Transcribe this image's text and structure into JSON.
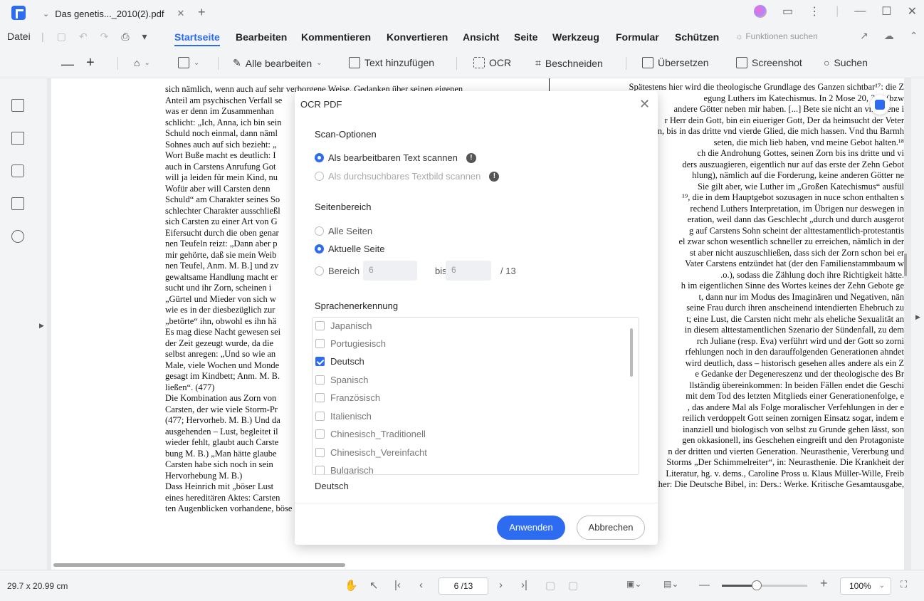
{
  "tab": {
    "title": "Das genetis..._2010(2).pdf"
  },
  "menu": {
    "datei": "Datei",
    "items": [
      "Startseite",
      "Bearbeiten",
      "Kommentieren",
      "Konvertieren",
      "Ansicht",
      "Seite",
      "Werkzeug",
      "Formular",
      "Schützen"
    ],
    "search_features": "Funktionen suchen"
  },
  "toolbar": {
    "edit_all": "Alle bearbeiten",
    "add_text": "Text hinzufügen",
    "ocr": "OCR",
    "crop": "Beschneiden",
    "translate": "Übersetzen",
    "screenshot": "Screenshot",
    "search": "Suchen"
  },
  "document": {
    "left_page": [
      "sich nämlich, wenn auch auf sehr verborgene Weise, Gedanken über seinen eigenen",
      "Anteil am psychischen Verfall se",
      "was er denn im Zusammenhan",
      "schlicht: „Ich, Anna, ich bin sein",
      "Schuld noch einmal, dann näml",
      "Sohnes auch auf sich bezieht: „",
      "Wort Buße macht es deutlich: I",
      "auch in Carstens Anrufung Got",
      "will ja leiden für mein Kind, nu",
      "Wofür aber will Carsten denn",
      "Schuld“ am Charakter seines So",
      "schlechter Charakter ausschließl",
      "sich Carsten zu einer Art von G",
      "Eifersucht durch die oben genar",
      "nen Teufeln reizt: „Dann aber p",
      "mir gehörte, daß sie mein Weib",
      "nen Teufel, Anm. M. B.] und zv",
      "gewaltsame Handlung macht er",
      "sucht und ihr Zorn, scheinen i",
      "„Gürtel und Mieder von sich w",
      "wie es in der diesbezüglich zur",
      "„betörte“ ihn, obwohl es ihn hä",
      "Es mag diese Nacht gewesen sei",
      "der Zeit gezeugt wurde, da die",
      "selbst anregen: „Und so wie an",
      "Male, viele Wochen und Monde",
      "gesagt im Kindbett; Anm. M. B.",
      "ließen“. (477)",
      "Die Kombination aus Zorn von",
      "Carsten, der wie viele Storm-Pr",
      "(477; Hervorheb. M. B.) Und da",
      "ausgehenden – Lust, begleitet il",
      "wieder fehlt, glaubt auch Carste",
      "bung M. B.) „Man hätte glaube",
      "Carsten habe sich noch in sein",
      "Hervorhebung M. B.)",
      "Dass Heinrich mit „böser Lust",
      "eines hereditären Aktes: Carsten",
      "ten Augenblicken vorhandene, böse Lust an seinem Sohn weiter, sondern durch eben"
    ],
    "right_page": [
      "Spätestens hier wird die theologische Grundlage des Ganzen sichtbar¹⁷: die Z",
      "egung Luthers im Katechismus. In 2 Mose 20, 3–6 (bzw",
      "",
      "andere Götter neben mir haben. [...] Bete sie nicht an vnd diene i",
      "r Herr dein Gott, bin ein eiueriger Gott, Der da heimsucht der Veter",
      "n, bis in das dritte vnd vierde Glied, die mich hassen. Vnd thu Barmh",
      "seten, die mich lieb haben, vnd meine Gebot halten.¹⁸",
      "ch die Androhung Gottes, seinen Zorn bis ins dritte und vi",
      "ders auszuagieren, eigentlich nur auf das erste der Zehn Gebot",
      "hlung), nämlich auf die Forderung, keine anderen Götter ne",
      "Sie gilt aber, wie Luther im „Großen Katechismus“ ausfül",
      "¹⁹, die in dem Hauptgebot sozusagen in nuce schon enthalten s",
      "rechend Luthers Interpretation, im Übrigen nur deswegen in",
      "eration, weil dann das Geschlecht „durch und durch ausgerot",
      "g auf Carstens Sohn scheint der alttestamentlich-protestantis",
      "el zwar schon wesentlich schneller zu erreichen, nämlich in der",
      "st aber nicht auszuschließen, dass sich der Zorn schon bei er",
      "Vater Carstens entzündet hat (der den Familienstammbaum w",
      ".o.), sodass die Zählung doch ihre Richtigkeit hätte.",
      "h im eigentlichen Sinne des Wortes keines der Zehn Gebote ge",
      "t, dann nur im Modus des Imaginären und Negativen, nän",
      "seine Frau durch ihren anscheinend intendierten Ehebruch zu",
      "t; eine Lust, die Carsten nicht mehr als eheliche Sexualität an",
      "in diesem alttestamentlichen Szenario der Sündenfall, zu dem",
      "rch Juliane (resp. Eva) verführt wird und der Gott so zorni",
      "rfehlungen noch in den darauffolgenden Generationen ahndet",
      "wird deutlich, dass – historisch gesehen alles andere als ein Z",
      "e Gedanke der Degenereszenz und der theologische des Br",
      "llständig übereinkommen: In beiden Fällen endet die Geschi",
      "mit dem Tod des letzten Mitglieds einer Generationenfolge, e",
      ", das andere Mal als Folge moralischer Verfehlungen in der e",
      "reilich verdoppelt Gott seinen zornigen Einsatz sogar, indem e",
      "inanziell und biologisch von selbst zu Grunde gehen lässt, son",
      "gen okkasionell, ins Geschehen eingreift und den Protagoniste",
      "",
      "n der dritten und vierten Generation. Neurasthenie, Vererbung und",
      "Storms „Der Schimmelreiter“, in: Neurasthenie. Die Krankheit der",
      "Literatur, hg. v. dems., Caroline Pross u. Klaus Müller-Wille, Freib",
      "",
      "Martin Luther: Die Deutsche Bibel, in: Ders.: Werke. Kritische Gesamtausgabe,"
    ]
  },
  "dialog": {
    "title": "OCR PDF",
    "scan_options_title": "Scan-Optionen",
    "scan_editable": "Als bearbeitbaren Text scannen",
    "scan_searchable": "Als durchsuchbares Textbild scannen",
    "page_range_title": "Seitenbereich",
    "all_pages": "Alle Seiten",
    "current_page": "Aktuelle Seite",
    "range": "Bereich",
    "range_from": "6",
    "range_to_label": "bis",
    "range_to": "6",
    "range_total": "/ 13",
    "language_title": "Sprachenerkennung",
    "languages": [
      {
        "name": "Japanisch",
        "checked": false
      },
      {
        "name": "Portugiesisch",
        "checked": false
      },
      {
        "name": "Deutsch",
        "checked": true
      },
      {
        "name": "Spanisch",
        "checked": false
      },
      {
        "name": "Französisch",
        "checked": false
      },
      {
        "name": "Italienisch",
        "checked": false
      },
      {
        "name": "Chinesisch_Traditionell",
        "checked": false
      },
      {
        "name": "Chinesisch_Vereinfacht",
        "checked": false
      },
      {
        "name": "Bulgarisch",
        "checked": false
      }
    ],
    "selected_languages": "Deutsch",
    "apply": "Anwenden",
    "cancel": "Abbrechen"
  },
  "status": {
    "page_size": "29.7 x 20.99 cm",
    "page_indicator": "6 /13",
    "zoom": "100%"
  }
}
